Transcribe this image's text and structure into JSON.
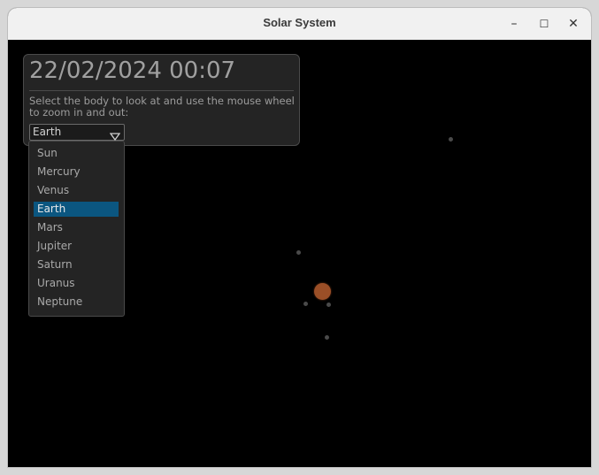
{
  "window": {
    "title": "Solar System",
    "minimize_glyph": "–",
    "maximize_glyph": "☐",
    "close_glyph": "✕"
  },
  "panel": {
    "datetime": "22/02/2024 00:07",
    "help_text": "Select the body to look at and use the mouse wheel to zoom in and out:",
    "selected_body": "Earth"
  },
  "bodies_menu": {
    "options": [
      "Sun",
      "Mercury",
      "Venus",
      "Earth",
      "Mars",
      "Jupiter",
      "Saturn",
      "Uranus",
      "Neptune"
    ],
    "selected": "Earth"
  },
  "colors": {
    "planet_main": "#9b4f27",
    "planet_small": "#4a4a4a",
    "selection": "#0b5680"
  },
  "icons": {
    "minimize": "minimize-icon",
    "maximize": "maximize-icon",
    "close": "close-icon",
    "dropdown": "triangle-down-icon"
  }
}
